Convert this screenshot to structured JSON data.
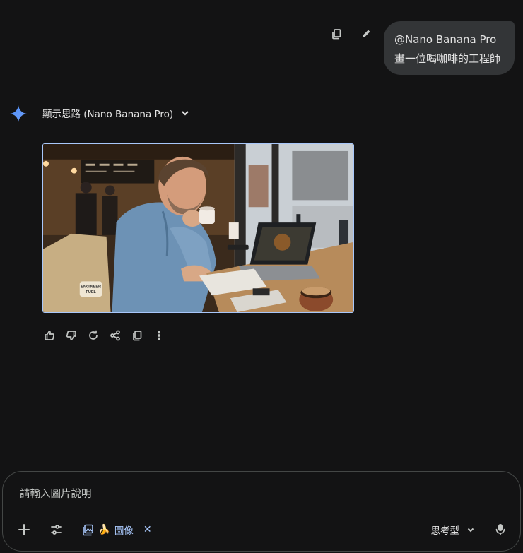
{
  "user_message": {
    "line1": "@Nano Banana Pro",
    "line2": "畫一位喝咖啡的工程師",
    "copy_icon": "copy-icon",
    "edit_icon": "pencil-icon"
  },
  "response": {
    "logo_icon": "gemini-sparkle-icon",
    "thinking_label": "顯示思路 (Nano Banana Pro)",
    "image_alt": "engineer drinking coffee at cafe with laptop",
    "image_badge": "ENGINEER FUEL",
    "actions": [
      "thumbs-up-icon",
      "thumbs-down-icon",
      "regenerate-icon",
      "share-icon",
      "copy-icon",
      "more-vert-icon"
    ]
  },
  "composer": {
    "placeholder": "請輸入圖片說明",
    "value": "",
    "chip_emoji": "🍌",
    "chip_label": "圖像",
    "chip_close": "✕",
    "mode_label": "思考型"
  },
  "colors": {
    "background": "#131314",
    "bubble": "#333537",
    "accent": "#a8c7fa",
    "text": "#e3e3e3",
    "muted": "#c4c7c5"
  }
}
